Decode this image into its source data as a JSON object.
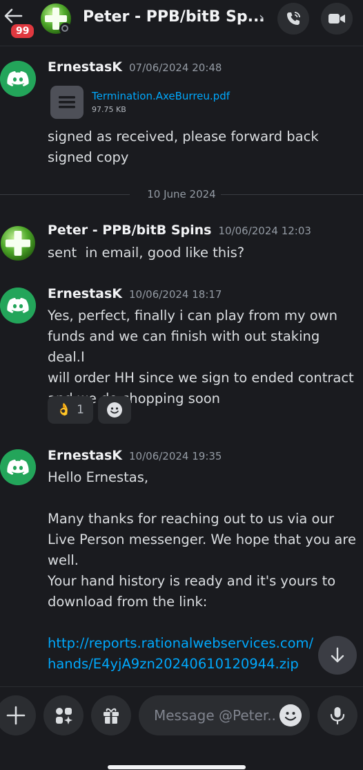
{
  "header": {
    "title": "Peter - PPB/bitB Sp...",
    "badge_count": "99",
    "chevron": "›",
    "icons": [
      "back-arrow-icon",
      "phone-call-icon",
      "video-camera-icon"
    ]
  },
  "messages": [
    {
      "author": "ErnestasK",
      "timestamp": "07/06/2024 20:48",
      "attachment": {
        "name": "Termination.AxeBurreu.pdf",
        "size": "97.75 KB"
      },
      "text": "signed as received, please forward back\nsigned copy"
    },
    {
      "author": "Peter - PPB/bitB Spins",
      "timestamp": "10/06/2024 12:03",
      "text": "sent  in email, good like this?"
    },
    {
      "author": "ErnestasK",
      "timestamp": "10/06/2024 18:17",
      "text": "Yes, perfect, finally i can play from my own\nfunds and we can finish with out staking deal.I\nwill order HH since we sign to ended contract\nand we do chopping soon",
      "reactions": [
        {
          "emoji": "👌",
          "count": "1"
        }
      ]
    },
    {
      "author": "ErnestasK",
      "timestamp": "10/06/2024 19:35",
      "text": "Hello Ernestas,\n\nMany thanks for reaching out to us via our\nLive Person messenger. We hope that you are\nwell.\nYour hand history is ready and it's yours to\ndownload from the link:\n",
      "link": "http://reports.rationalwebservices.com/\nhands/E4yjA9zn20240610120944.zip"
    }
  ],
  "date_divider": "10 June 2024",
  "composer": {
    "placeholder": "Message @Peter..",
    "icons": [
      "plus-icon",
      "apps-icon",
      "gift-icon",
      "emoji-icon",
      "microphone-icon"
    ]
  },
  "colors": {
    "link": "#00a8fc",
    "badge": "#e0383f",
    "discord_green": "#23a55a",
    "background": "#1a1b1f"
  }
}
